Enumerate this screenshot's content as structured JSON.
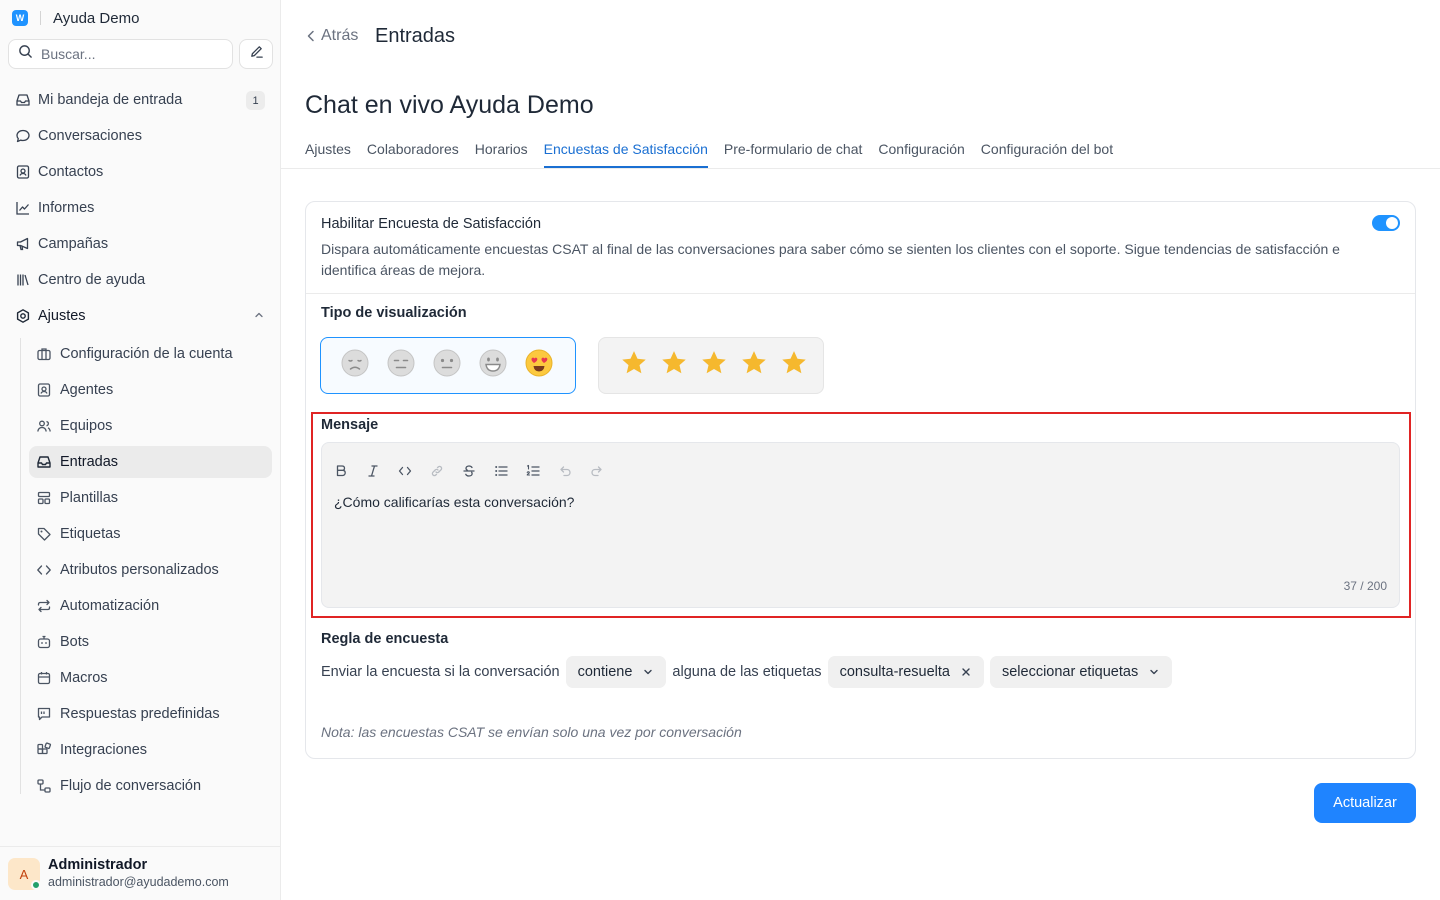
{
  "sidebar": {
    "brand_logo": "W",
    "brand_name": "Ayuda Demo",
    "search_placeholder": "Buscar...",
    "items": [
      {
        "label": "Mi bandeja de entrada",
        "icon": "inbox-icon",
        "badge": "1"
      },
      {
        "label": "Conversaciones",
        "icon": "chat-bubble-icon"
      },
      {
        "label": "Contactos",
        "icon": "contact-card-icon"
      },
      {
        "label": "Informes",
        "icon": "line-chart-icon"
      },
      {
        "label": "Campañas",
        "icon": "megaphone-icon"
      },
      {
        "label": "Centro de ayuda",
        "icon": "library-icon"
      },
      {
        "label": "Ajustes",
        "icon": "settings-icon"
      }
    ],
    "settings_items": [
      {
        "label": "Configuración de la cuenta",
        "icon": "briefcase-icon"
      },
      {
        "label": "Agentes",
        "icon": "person-square-icon"
      },
      {
        "label": "Equipos",
        "icon": "users-icon"
      },
      {
        "label": "Entradas",
        "icon": "inbox-icon",
        "active": true
      },
      {
        "label": "Plantillas",
        "icon": "template-icon"
      },
      {
        "label": "Etiquetas",
        "icon": "tag-icon"
      },
      {
        "label": "Atributos personalizados",
        "icon": "code-icon"
      },
      {
        "label": "Automatización",
        "icon": "repeat-icon"
      },
      {
        "label": "Bots",
        "icon": "bot-icon"
      },
      {
        "label": "Macros",
        "icon": "calendar-icon"
      },
      {
        "label": "Respuestas predefinidas",
        "icon": "quick-reply-icon"
      },
      {
        "label": "Integraciones",
        "icon": "blocks-icon"
      },
      {
        "label": "Flujo de conversación",
        "icon": "flow-icon"
      }
    ],
    "user": {
      "initial": "A",
      "name": "Administrador",
      "email": "administrador@ayudademo.com",
      "status_color": "#22a06b"
    }
  },
  "header": {
    "back_label": "Atrás",
    "title": "Entradas"
  },
  "inbox": {
    "name": "Chat en vivo Ayuda Demo",
    "tabs": [
      {
        "label": "Ajustes"
      },
      {
        "label": "Colaboradores"
      },
      {
        "label": "Horarios"
      },
      {
        "label": "Encuestas de Satisfacción",
        "active": true
      },
      {
        "label": "Pre-formulario de chat"
      },
      {
        "label": "Configuración"
      },
      {
        "label": "Configuración del bot"
      }
    ]
  },
  "csat": {
    "enable_title": "Habilitar Encuesta de Satisfacción",
    "enable_description": "Dispara automáticamente encuestas CSAT al final de las conversaciones para saber cómo se sienten los clientes con el soporte. Sigue tendencias de satisfacción e identifica áreas de mejora.",
    "enabled": true,
    "display_type_label": "Tipo de visualización",
    "display_types": {
      "selected": "emoji",
      "emoji": [
        "😞",
        "😑",
        "😐",
        "😀",
        "😍"
      ],
      "stars": [
        "★",
        "★",
        "★",
        "★",
        "★"
      ]
    },
    "message_label": "Mensaje",
    "toolbar": [
      "bold-icon",
      "italic-icon",
      "code-icon",
      "link-icon",
      "strikethrough-icon",
      "bullet-list-icon",
      "ordered-list-icon",
      "undo-icon",
      "redo-icon"
    ],
    "message_value": "¿Cómo calificarías esta conversación?",
    "char_count": "37 / 200",
    "rule_label": "Regla de encuesta",
    "rule": {
      "prefix": "Enviar la encuesta si la conversación",
      "operator": "contiene",
      "middle": "alguna de las etiquetas",
      "selected_tag": "consulta-resuelta",
      "tag_placeholder": "seleccionar etiquetas"
    },
    "note": "Nota: las encuestas CSAT se envían solo una vez por conversación"
  },
  "actions": {
    "update_label": "Actualizar"
  },
  "colors": {
    "accent": "#1f93ff",
    "active_tab": "#1a6fd2",
    "highlight": "#e02424",
    "star": "#f5b82e"
  }
}
